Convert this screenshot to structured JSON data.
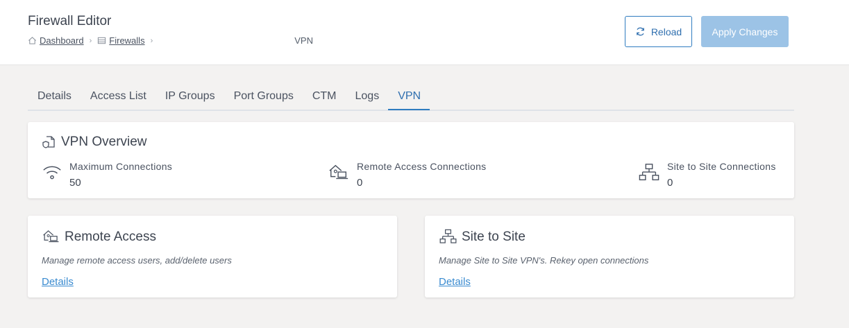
{
  "header": {
    "title": "Firewall Editor",
    "breadcrumb": {
      "dashboard": "Dashboard",
      "firewalls": "Firewalls",
      "current": "VPN"
    },
    "reload_label": "Reload",
    "apply_label": "Apply Changes"
  },
  "tabs": [
    {
      "label": "Details"
    },
    {
      "label": "Access List"
    },
    {
      "label": "IP Groups"
    },
    {
      "label": "Port Groups"
    },
    {
      "label": "CTM"
    },
    {
      "label": "Logs"
    },
    {
      "label": "VPN",
      "active": true
    }
  ],
  "overview": {
    "title": "VPN Overview",
    "stats": [
      {
        "label": "Maximum Connections",
        "value": "50",
        "icon": "wifi-icon"
      },
      {
        "label": "Remote Access Connections",
        "value": "0",
        "icon": "home-laptop-icon"
      },
      {
        "label": "Site to Site Connections",
        "value": "0",
        "icon": "network-icon"
      }
    ]
  },
  "remote_access": {
    "title": "Remote Access",
    "description": "Manage remote access users, add/delete users",
    "link": "Details"
  },
  "site_to_site": {
    "title": "Site to Site",
    "description": "Manage Site to Site VPN's. Rekey open connections",
    "link": "Details"
  },
  "colors": {
    "accent": "#2f7cc0",
    "apply_disabled": "#9cc3e6",
    "link": "#3a8bd0",
    "background": "#f3f2f1"
  }
}
